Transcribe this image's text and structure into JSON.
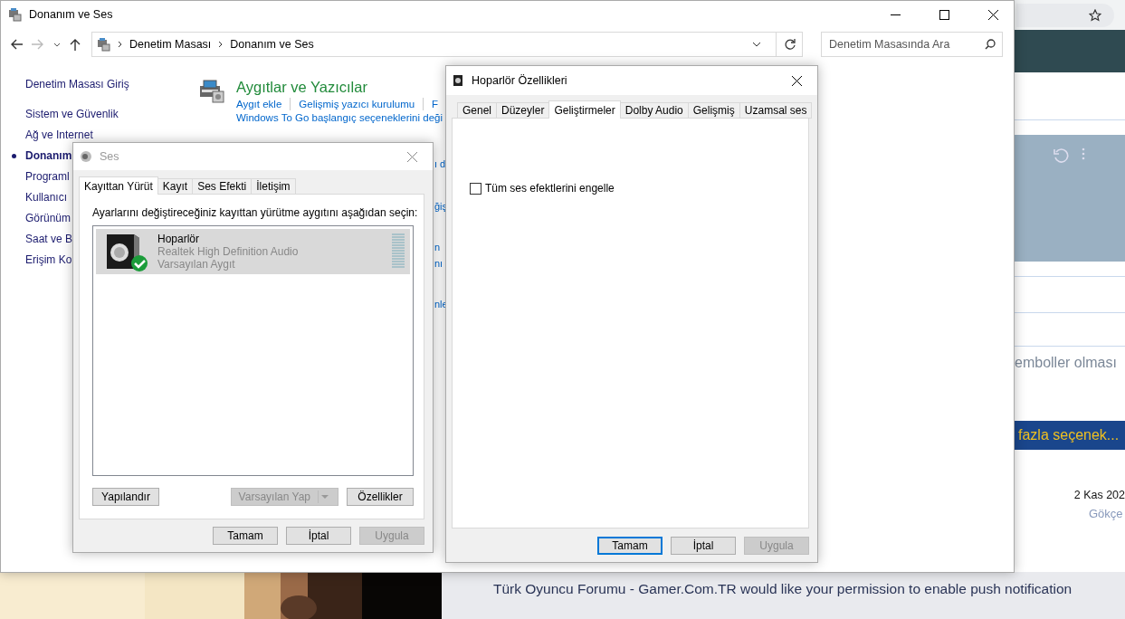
{
  "browser": {
    "notification": "Türk Oyuncu Forumu - Gamer.Com.TR would like your permission to enable push notification",
    "snippet": "emboller olması",
    "more_button": "fazla seçenek...",
    "date": "2 Kas 202",
    "author": "Gökçe"
  },
  "control_panel": {
    "title": "Donanım ve Ses",
    "breadcrumb": [
      "Denetim Masası",
      "Donanım ve Ses"
    ],
    "search": {
      "placeholder": "Denetim Masasında Ara"
    },
    "home_link": "Denetim Masası Giriş",
    "sidebar": [
      {
        "label": "Sistem ve Güvenlik",
        "selected": false
      },
      {
        "label": "Ağ ve Internet",
        "selected": false
      },
      {
        "label": "Donanım",
        "selected": true
      },
      {
        "label": "Programl",
        "selected": false
      },
      {
        "label": "Kullanıcı",
        "selected": false
      },
      {
        "label": "Görünüm",
        "selected": false
      },
      {
        "label": "Saat ve B",
        "selected": false
      },
      {
        "label": "Erişim Ko",
        "selected": false
      }
    ],
    "section": {
      "title": "Aygıtlar ve Yazıcılar",
      "links": [
        "Aygıt ekle",
        "Gelişmiş yazıcı kurulumu",
        "F"
      ],
      "second_line": "Windows To Go başlangıç seçeneklerini deği"
    },
    "partial_links": [
      "ı d",
      "ğiş",
      "n",
      "nı",
      "nle"
    ]
  },
  "sound_dialog": {
    "title": "Ses",
    "active": false,
    "tabs": [
      {
        "label": "Kayıttan Yürüt",
        "selected": true
      },
      {
        "label": "Kayıt",
        "selected": false
      },
      {
        "label": "Ses Efekti",
        "selected": false
      },
      {
        "label": "İletişim",
        "selected": false
      }
    ],
    "instruction": "Ayarlarını değiştireceğiniz kayıttan yürütme aygıtını aşağıdan seçin:",
    "devices": [
      {
        "name": "Hoparlör",
        "driver": "Realtek High Definition Audio",
        "status": "Varsayılan Aygıt",
        "selected": true,
        "default": true
      }
    ],
    "panel_buttons": [
      {
        "label": "Yapılandır",
        "kind": "plain",
        "disabled": false
      },
      {
        "label": "Varsayılan Yap",
        "kind": "split",
        "disabled": true
      },
      {
        "label": "Özellikler",
        "kind": "plain",
        "disabled": false
      }
    ],
    "buttons": [
      {
        "label": "Tamam",
        "disabled": false,
        "default": false
      },
      {
        "label": "İptal",
        "disabled": false,
        "default": false
      },
      {
        "label": "Uygula",
        "disabled": true,
        "default": false
      }
    ]
  },
  "properties_dialog": {
    "title": "Hoparlör Özellikleri",
    "active": true,
    "tabs": [
      {
        "label": "Genel",
        "selected": false
      },
      {
        "label": "Düzeyler",
        "selected": false
      },
      {
        "label": "Geliştirmeler",
        "selected": true
      },
      {
        "label": "Dolby Audio",
        "selected": false
      },
      {
        "label": "Gelişmiş",
        "selected": false
      },
      {
        "label": "Uzamsal ses",
        "selected": false
      }
    ],
    "checkbox": {
      "label": "Tüm ses efektlerini engelle",
      "checked": false
    },
    "buttons": [
      {
        "label": "Tamam",
        "disabled": false,
        "default": true
      },
      {
        "label": "İptal",
        "disabled": false,
        "default": false
      },
      {
        "label": "Uygula",
        "disabled": true,
        "default": false
      }
    ]
  }
}
